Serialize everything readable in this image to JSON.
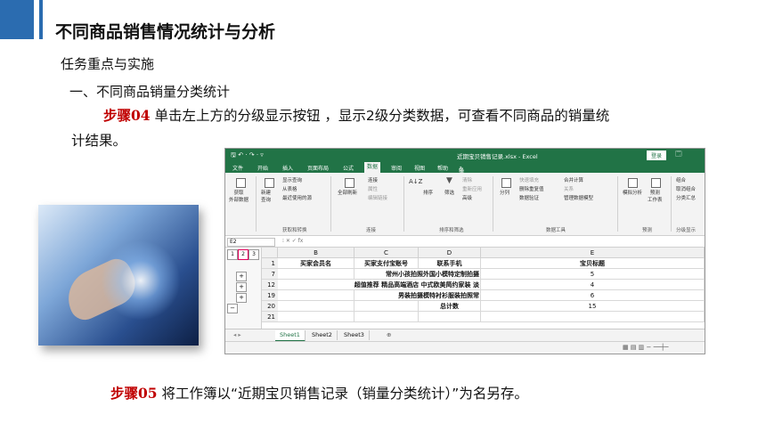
{
  "slide": {
    "title": "不同商品销售情况统计与分析",
    "subtitle": "任务重点与实施",
    "section": "一、不同商品销量分类统计",
    "step1_label": "步骤04",
    "step1_text": " 单击左上方的分级显示按钮 ，显示2级分类数据，可查看不同商品的销量统",
    "step1_text_cont": "计结果。",
    "step2_label": "步骤05",
    "step2_text": " 将工作簿以“近期宝贝销售记录（销量分类统计）”为名另存。"
  },
  "excel": {
    "doc_title": "近期宝贝销售记录.xlsx - Excel",
    "quick_access": "🖫 ↶ · ↷ · ▿",
    "login": "登录",
    "window_ctl": "🗔",
    "tabs": [
      "文件",
      "开始",
      "插入",
      "页面布局",
      "公式",
      "数据",
      "审阅",
      "视图",
      "帮助",
      "操作说明搜索"
    ],
    "active_tab": "数据",
    "ribbon": {
      "get_external": "获取\n外部数据",
      "new_query": "新建\n查询",
      "show_query": "显示查询",
      "from_table": "从表格",
      "recent_sources": "最近使用的源",
      "group_get": "获取和转换",
      "refresh_all": "全部刷新",
      "connections": "连接",
      "properties": "属性",
      "edit_links": "编辑链接",
      "group_conn": "连接",
      "sort_az": "A↓Z",
      "sort": "排序",
      "filter": "筛选",
      "clear": "清除",
      "reapply": "重新应用",
      "advanced": "高级",
      "group_sort": "排序和筛选",
      "split": "分列",
      "flash_fill": "快速填充",
      "remove_dup": "删除重复值",
      "validation": "数据验证",
      "merge_calc": "合并计算",
      "relations": "关系",
      "data_model": "管理数据模型",
      "group_tools": "数据工具",
      "what_if": "模拟分析",
      "forecast": "预测\n工作表",
      "group_forecast": "预测",
      "group_btn": "组合",
      "ungroup": "取消组合",
      "subtotal": "分类汇总",
      "group_outline": "分级显示"
    },
    "name_box": "E2",
    "fx_symbols": "⁝   ✕  ✓  fx",
    "outline_levels": [
      "1",
      "2",
      "3"
    ],
    "columns": [
      "B",
      "C",
      "D",
      "E"
    ],
    "rows": [
      {
        "num": "1",
        "b": "买家会员名",
        "c": "买家支付宝账号",
        "d": "联系手机",
        "e": "宝贝标题",
        "header": true
      },
      {
        "num": "7",
        "b": "",
        "c": "常州小孩拍照外国小模特定制拍摄",
        "d": "",
        "e": "5"
      },
      {
        "num": "12",
        "b": "超值推荐 精品高端酒店 中式欧美简约家装 淡",
        "c": "",
        "d": "",
        "e": "4"
      },
      {
        "num": "19",
        "b": "",
        "c": "男装拍摄模特衬衫服装拍照常",
        "d": "",
        "e": "6"
      },
      {
        "num": "20",
        "b": "",
        "c": "",
        "d": "总计数",
        "e": "15"
      },
      {
        "num": "21",
        "b": "",
        "c": "",
        "d": "",
        "e": ""
      }
    ],
    "sheets": [
      "Sheet1",
      "Sheet2",
      "Sheet3"
    ],
    "active_sheet": "Sheet1",
    "add_sheet": "⊕"
  }
}
